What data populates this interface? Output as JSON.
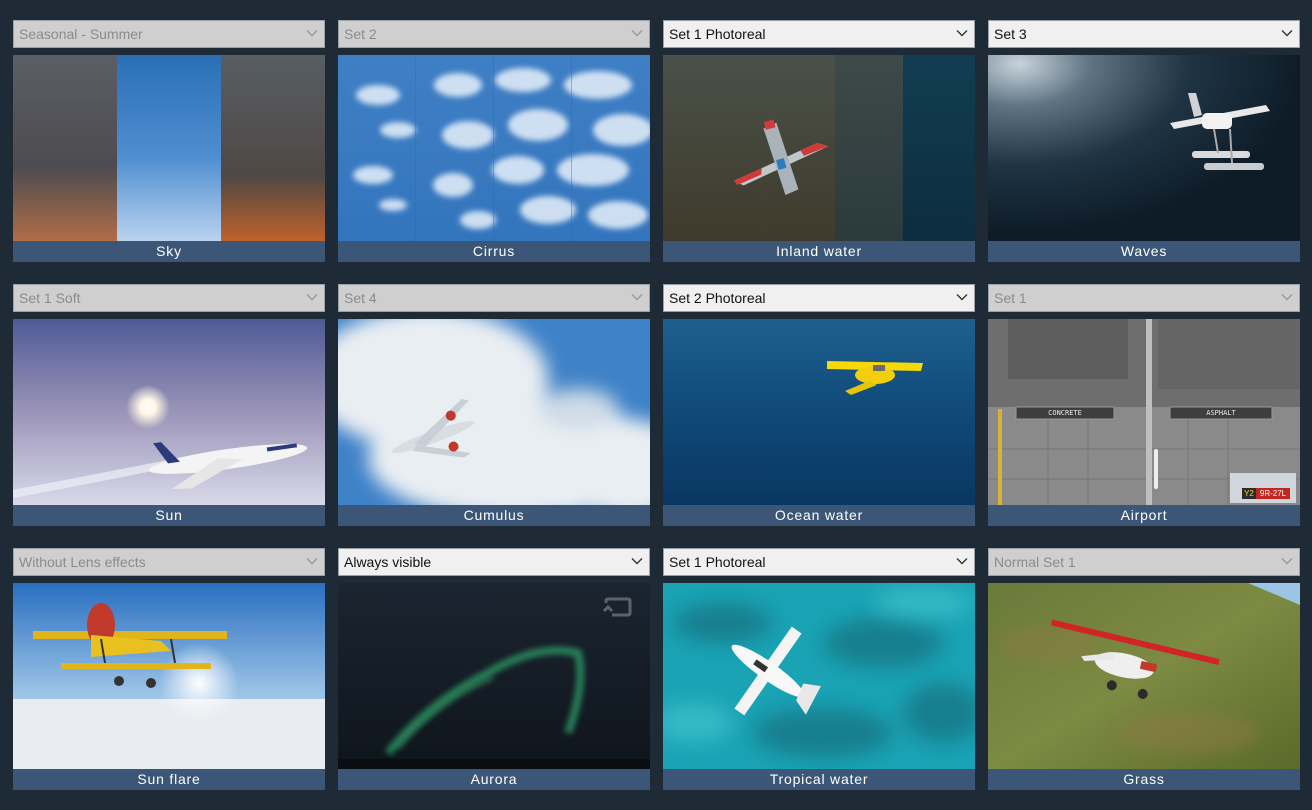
{
  "tiles": [
    {
      "id": "sky",
      "label": "Sky",
      "selected": "Seasonal - Summer",
      "enabled": false
    },
    {
      "id": "cirrus",
      "label": "Cirrus",
      "selected": "Set 2",
      "enabled": false
    },
    {
      "id": "inland-water",
      "label": "Inland water",
      "selected": "Set 1 Photoreal",
      "enabled": true
    },
    {
      "id": "waves",
      "label": "Waves",
      "selected": "Set 3",
      "enabled": true
    },
    {
      "id": "sun",
      "label": "Sun",
      "selected": "Set 1 Soft",
      "enabled": false
    },
    {
      "id": "cumulus",
      "label": "Cumulus",
      "selected": "Set 4",
      "enabled": false
    },
    {
      "id": "ocean-water",
      "label": "Ocean water",
      "selected": "Set 2 Photoreal",
      "enabled": true
    },
    {
      "id": "airport",
      "label": "Airport",
      "selected": "Set 1",
      "enabled": false,
      "signs": {
        "concrete": "CONCRETE",
        "asphalt": "ASPHALT",
        "runway_left": "Y2",
        "runway_right": "9R-27L"
      }
    },
    {
      "id": "sun-flare",
      "label": "Sun flare",
      "selected": "Without Lens effects",
      "enabled": false
    },
    {
      "id": "aurora",
      "label": "Aurora",
      "selected": "Always visible",
      "enabled": true
    },
    {
      "id": "tropical-water",
      "label": "Tropical water",
      "selected": "Set 1 Photoreal",
      "enabled": true
    },
    {
      "id": "grass",
      "label": "Grass",
      "selected": "Normal Set 1",
      "enabled": false
    }
  ],
  "icons": {
    "dropdown": "chevron-down-icon",
    "aurora_badge": "repeat-icon"
  },
  "colors": {
    "background": "#1f2a37",
    "caption": "#3b5677",
    "dropdown_enabled": "#f0f0f0",
    "dropdown_disabled": "#cfcfcf"
  }
}
